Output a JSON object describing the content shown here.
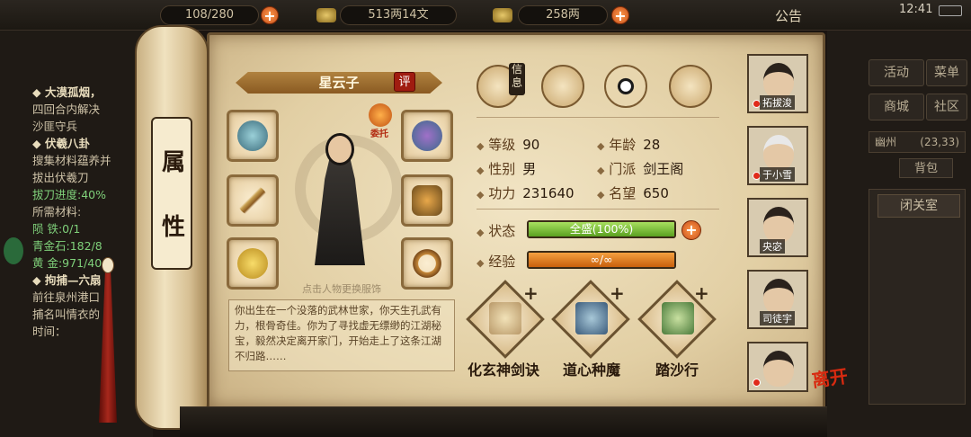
{
  "topbar": {
    "stamina": "108/280",
    "money": "513两14文",
    "gold": "258两",
    "notice": "公告",
    "time": "12:41"
  },
  "leftpanel": {
    "lines": [
      {
        "text": "◆ 大漠孤烟，",
        "kind": "head"
      },
      {
        "text": "四回合内解决",
        "kind": "normal"
      },
      {
        "text": "沙匪守兵",
        "kind": "normal"
      },
      {
        "text": "◆ 伏羲八卦",
        "kind": "head"
      },
      {
        "text": "搜集材料蕴养并",
        "kind": "normal"
      },
      {
        "text": "拔出伏羲刀",
        "kind": "normal"
      },
      {
        "text": "拔刀进度:40%",
        "kind": "green"
      },
      {
        "text": "所需材料:",
        "kind": "normal"
      },
      {
        "text": "陨  铁:0/1",
        "kind": "green"
      },
      {
        "text": "青金石:182/8",
        "kind": "green"
      },
      {
        "text": "黄  金:971/40",
        "kind": "green"
      },
      {
        "text": "◆ 拘捕—六扇",
        "kind": "head"
      },
      {
        "text": "前往泉州港口",
        "kind": "normal"
      },
      {
        "text": "捕名叫情衣的",
        "kind": "normal"
      },
      {
        "text": "时间：",
        "kind": "normal"
      }
    ]
  },
  "rightpanel": {
    "buttons": [
      "活动",
      "菜单",
      "商城",
      "社区"
    ],
    "location": "幽州",
    "coords": "(23,33)",
    "bag": "背包",
    "closed_room": "闭关室"
  },
  "scroll": {
    "roll_chars": [
      "属",
      "性"
    ]
  },
  "character": {
    "name": "星云子",
    "ping": "评",
    "delegate": "委托",
    "click_hint": "点击人物更换服饰",
    "description": "你出生在一个没落的武林世家，你天生孔武有力，根骨奇佳。你为了寻找虚无缥缈的江湖秘宝，毅然决定离开家门，开始走上了这条江湖不归路……"
  },
  "tabs": {
    "info_label": "信息",
    "items": [
      "info-tab-icon",
      "map-tab-icon",
      "bagua-tab-icon",
      "body-tab-icon"
    ]
  },
  "stats": {
    "level_label": "等级",
    "level": "90",
    "age_label": "年龄",
    "age": "28",
    "gender_label": "性别",
    "gender": "男",
    "sect_label": "门派",
    "sect": "剑王阁",
    "power_label": "功力",
    "power": "231640",
    "fame_label": "名望",
    "fame": "650",
    "status_label": "状态",
    "status": "全盛(100%)",
    "status_fill": 1.0,
    "exp_label": "经验",
    "exp": "∞/∞",
    "exp_fill": 1.0
  },
  "skills": [
    {
      "name": "化玄神剑诀",
      "plus": "+"
    },
    {
      "name": "道心种魔",
      "plus": "+"
    },
    {
      "name": "踏沙行",
      "plus": "+"
    }
  ],
  "portraits": [
    {
      "name": "拓拔浚"
    },
    {
      "name": "于小雪"
    },
    {
      "name": "央宓"
    },
    {
      "name": "司徒宇"
    },
    {
      "name": ""
    }
  ],
  "leave": "离开",
  "colors": {
    "accent": "#8a5a22",
    "status_green": "#7fc83a",
    "exp_orange": "#e8801c",
    "paper": "#e2cfa4"
  }
}
